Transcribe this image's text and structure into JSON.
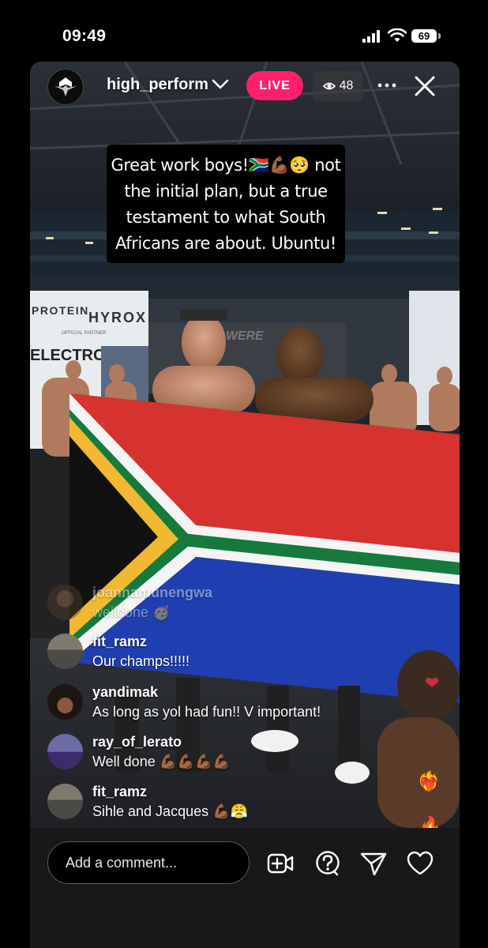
{
  "status_bar": {
    "time": "09:49",
    "battery": "69"
  },
  "live": {
    "host_username": "high_perform",
    "live_label": "LIVE",
    "viewer_count": "48"
  },
  "caption": {
    "line1": "Great work boys!🇿🇦💪🏾🥺 not",
    "line2": "the initial plan, but a true",
    "line3": "testament to what South",
    "line4": "Africans are about. Ubuntu!"
  },
  "scene_text": {
    "protein": "PROTEIN",
    "hyrox": "HYROX",
    "official_partner": "OFFICIAL PARTNER",
    "electro": "ELECTRO",
    "you_were": "YOU WERE"
  },
  "comments": [
    {
      "username": "joannamunengwa",
      "text": "welldone 🥳"
    },
    {
      "username": "fit_ramz",
      "text": "Our champs!!!!!"
    },
    {
      "username": "yandimak",
      "text": "As long as yol had fun!! V important!"
    },
    {
      "username": "ray_of_lerato",
      "text": "Well done 💪🏾💪🏾💪🏾💪🏾"
    },
    {
      "username": "fit_ramz",
      "text": "Sihle and Jacques 💪🏾😤"
    }
  ],
  "comment_bar": {
    "placeholder": "Add a comment...",
    "icons": [
      "add-video-icon",
      "question-icon",
      "send-icon",
      "heart-icon"
    ]
  },
  "colors": {
    "live_badge": "#ff1f6d",
    "background": "#000000"
  }
}
